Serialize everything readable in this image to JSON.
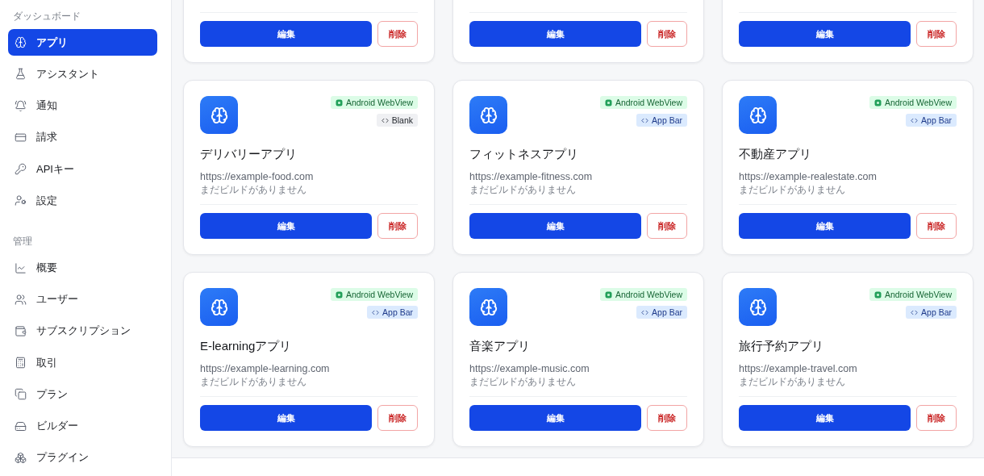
{
  "sidebar": {
    "sections": [
      {
        "label": "ダッシュボード",
        "items": [
          {
            "label": "アプリ",
            "selected": true
          },
          {
            "label": "アシスタント",
            "selected": false
          },
          {
            "label": "通知",
            "selected": false
          },
          {
            "label": "請求",
            "selected": false
          },
          {
            "label": "APIキー",
            "selected": false
          },
          {
            "label": "設定",
            "selected": false
          }
        ]
      },
      {
        "label": "管理",
        "items": [
          {
            "label": "概要",
            "selected": false
          },
          {
            "label": "ユーザー",
            "selected": false
          },
          {
            "label": "サブスクリプション",
            "selected": false
          },
          {
            "label": "取引",
            "selected": false
          },
          {
            "label": "プラン",
            "selected": false
          },
          {
            "label": "ビルダー",
            "selected": false
          },
          {
            "label": "プラグイン",
            "selected": false
          }
        ]
      }
    ]
  },
  "apps": [
    {
      "kind": "partial",
      "edit": "編集",
      "delete": "削除"
    },
    {
      "kind": "partial",
      "edit": "編集",
      "delete": "削除"
    },
    {
      "kind": "partial",
      "edit": "編集",
      "delete": "削除"
    },
    {
      "kind": "full",
      "platform": "Android WebView",
      "template": {
        "kind": "blank",
        "label": "Blank"
      },
      "name": "デリバリーアプリ",
      "url": "https://example-food.com",
      "note": "まだビルドがありません",
      "edit": "編集",
      "delete": "削除"
    },
    {
      "kind": "full",
      "platform": "Android WebView",
      "template": {
        "kind": "appbar",
        "label": "App Bar"
      },
      "name": "フィットネスアプリ",
      "url": "https://example-fitness.com",
      "note": "まだビルドがありません",
      "edit": "編集",
      "delete": "削除"
    },
    {
      "kind": "full",
      "platform": "Android WebView",
      "template": {
        "kind": "appbar",
        "label": "App Bar"
      },
      "name": "不動産アプリ",
      "url": "https://example-realestate.com",
      "note": "まだビルドがありません",
      "edit": "編集",
      "delete": "削除"
    },
    {
      "kind": "full",
      "platform": "Android WebView",
      "template": {
        "kind": "appbar",
        "label": "App Bar"
      },
      "name": "E-learningアプリ",
      "url": "https://example-learning.com",
      "note": "まだビルドがありません",
      "edit": "編集",
      "delete": "削除"
    },
    {
      "kind": "full",
      "platform": "Android WebView",
      "template": {
        "kind": "appbar",
        "label": "App Bar"
      },
      "name": "音楽アプリ",
      "url": "https://example-music.com",
      "note": "まだビルドがありません",
      "edit": "編集",
      "delete": "削除"
    },
    {
      "kind": "full",
      "platform": "Android WebView",
      "template": {
        "kind": "appbar",
        "label": "App Bar"
      },
      "name": "旅行予約アプリ",
      "url": "https://example-travel.com",
      "note": "まだビルドがありません",
      "edit": "編集",
      "delete": "削除"
    }
  ]
}
